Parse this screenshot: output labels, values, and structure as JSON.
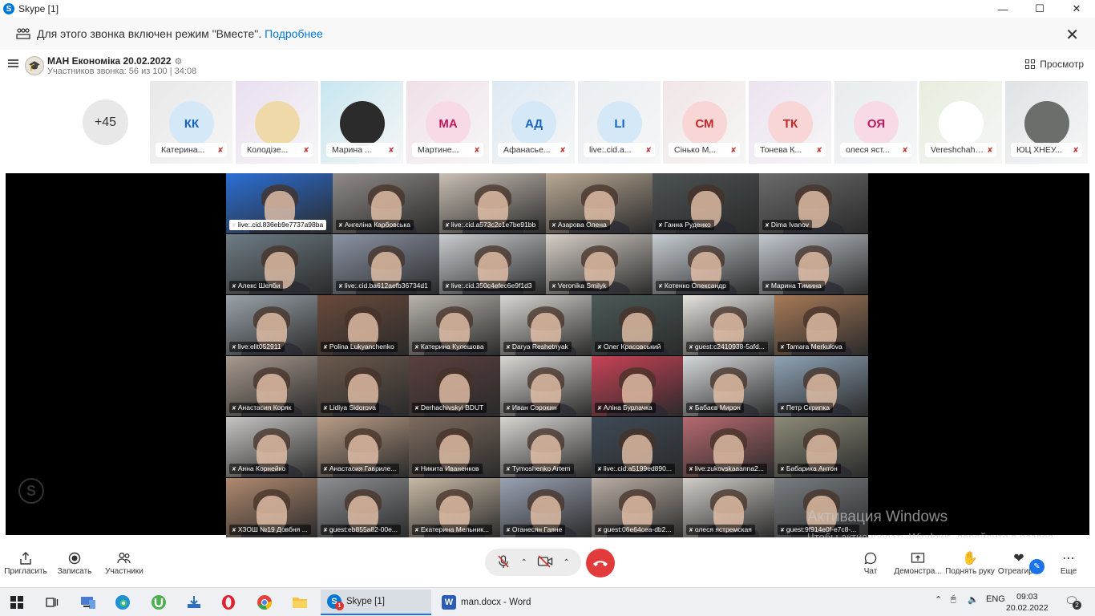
{
  "window": {
    "title": "Skype [1]"
  },
  "banner": {
    "message": "Для этого звонка включен режим \"Вместе\".",
    "link": "Подробнее"
  },
  "header": {
    "title": "МАН Економіка 20.02.2022",
    "subtitle": "Участников звонка: 56 из 100 | 34:08",
    "view_label": "Просмотр"
  },
  "strip": {
    "more_count": "+45",
    "participants": [
      {
        "initials": "КК",
        "name": "Катерина...",
        "bg": "#e8e8e8",
        "fg": "#1565c0",
        "circle": "#d5e8f7"
      },
      {
        "initials": "",
        "name": "Колодізе...",
        "bg": "#e9dff0",
        "fg": "#333",
        "circle": "#f0d9a8"
      },
      {
        "initials": "",
        "name": "Марина ...",
        "bg": "#c7e6ef",
        "fg": "#333",
        "circle": "#2b2b2b"
      },
      {
        "initials": "МА",
        "name": "Мартине...",
        "bg": "#efe0e8",
        "fg": "#c2185b",
        "circle": "#f8d9e6"
      },
      {
        "initials": "АД",
        "name": "Афанасье...",
        "bg": "#dde9f3",
        "fg": "#1565c0",
        "circle": "#d5e8f7"
      },
      {
        "initials": "LI",
        "name": "live:.cid.a...",
        "bg": "#e9eef2",
        "fg": "#1565c0",
        "circle": "#d5e8f7"
      },
      {
        "initials": "СМ",
        "name": "Сінько М...",
        "bg": "#f1e6e6",
        "fg": "#c62828",
        "circle": "#f9d6d6"
      },
      {
        "initials": "ТК",
        "name": "Тонева К...",
        "bg": "#ece3f0",
        "fg": "#c62828",
        "circle": "#f9d6d6"
      },
      {
        "initials": "ОЯ",
        "name": "олеся яст...",
        "bg": "#e7ecef",
        "fg": "#c2185b",
        "circle": "#f8d9e6"
      },
      {
        "initials": "",
        "name": "Vereshchahin...",
        "bg": "#e6eedd",
        "fg": "#333",
        "circle": "#ffffff"
      },
      {
        "initials": "",
        "name": "ЮЦ ХНЕУ...",
        "bg": "#dfe3e6",
        "fg": "#333",
        "circle": "#6a6f6c"
      }
    ]
  },
  "grid": {
    "rows": [
      [
        {
          "name": "live:.cid.836eb9e7737a98ba",
          "bg": "#2b6fd6"
        },
        {
          "name": "Ангеліна Карбовська",
          "bg": "#8f8a86"
        },
        {
          "name": "live:.cid.a573c2c1e7be91bb",
          "bg": "#c9bfb4"
        },
        {
          "name": "Азарова Олена",
          "bg": "#b9a995"
        },
        {
          "name": "Ганна Руденко",
          "bg": "#4c5253"
        },
        {
          "name": "Dima Ivanov",
          "bg": "#6b6b6b"
        }
      ],
      [
        {
          "name": "Алекс Шелби",
          "bg": "#6d7c84"
        },
        {
          "name": "live:.cid.ba612aefb36734d1",
          "bg": "#8b93a4"
        },
        {
          "name": "live:.cid.350c4efec6e9f1d3",
          "bg": "#c9ccd0"
        },
        {
          "name": "Veronika Smilyk",
          "bg": "#d6cfc7"
        },
        {
          "name": "Котенко Олександр",
          "bg": "#c7cdd2"
        },
        {
          "name": "Марина Тимина",
          "bg": "#c2c8cf"
        }
      ],
      [
        {
          "name": "live:elit052911",
          "bg": "#9aa3aa"
        },
        {
          "name": "Polina Lukyanchenko",
          "bg": "#6a4a3b"
        },
        {
          "name": "Катерина Кулешова",
          "bg": "#b9b4ad"
        },
        {
          "name": "Darya Reshetnyak",
          "bg": "#d8d6d2"
        },
        {
          "name": "Олег Красовський",
          "bg": "#4b5a57"
        },
        {
          "name": "guest:c2410938-5afd...",
          "bg": "#e7e4df"
        },
        {
          "name": "Tamara Merkulova",
          "bg": "#a77a57"
        }
      ],
      [
        {
          "name": "Анастасия Коряк",
          "bg": "#a89a8e"
        },
        {
          "name": "Lidiya Sidorova",
          "bg": "#6c5a4d"
        },
        {
          "name": "Derhachivskyi BDUT",
          "bg": "#5b3f3f"
        },
        {
          "name": "Иван Сорокин",
          "bg": "#d9d7d4"
        },
        {
          "name": "Аліна Бурлачка",
          "bg": "#c74256"
        },
        {
          "name": "Бабаєв Мирон",
          "bg": "#d5d8db"
        },
        {
          "name": "Петр Скрипка",
          "bg": "#8fa3b6"
        }
      ],
      [
        {
          "name": "Анна Корнейко",
          "bg": "#c6c5c3"
        },
        {
          "name": "Анастасия Гавриле...",
          "bg": "#b99d87"
        },
        {
          "name": "Никита Иваненков",
          "bg": "#7d6b5e"
        },
        {
          "name": "Tymoshenko Artem",
          "bg": "#d7d5d2"
        },
        {
          "name": "live:.cid.a5199ed890...",
          "bg": "#3f4a56"
        },
        {
          "name": "live:zukovskaaanna2...",
          "bg": "#b66a6f"
        },
        {
          "name": "Бабарика Антон",
          "bg": "#8c8b78"
        }
      ],
      [
        {
          "name": "ХЗОШ №19 Довбня ...",
          "bg": "#b08a6f"
        },
        {
          "name": "guest:eb855a82-00e...",
          "bg": "#8d8f92"
        },
        {
          "name": "Екатерина Мельник...",
          "bg": "#c8b9a5"
        },
        {
          "name": "Оганесян Гаяне",
          "bg": "#9aa2b3"
        },
        {
          "name": "guest:06e64cea-db2...",
          "bg": "#b9aea4"
        },
        {
          "name": "олеся ястремская",
          "bg": "#d0cdc8"
        },
        {
          "name": "guest:9f914e0f-e7c8-...",
          "bg": "#7a7e82"
        }
      ]
    ]
  },
  "watermark": {
    "line1": "Активация Windows",
    "line2": "Чтобы активировать Windows, перейдите в раздел \"Параметры\"."
  },
  "controls": {
    "invite": "Пригласить",
    "record": "Записать",
    "participants": "Участники",
    "chat": "Чат",
    "share": "Демонстра...",
    "raise_hand": "Поднять руку",
    "react": "Отреагир...",
    "more": "Еще"
  },
  "taskbar": {
    "skype_label": "Skype [1]",
    "skype_badge": "1",
    "word_label": "man.docx - Word",
    "lang": "ENG",
    "time": "09:03",
    "date": "20.02.2022",
    "notif_count": "2"
  }
}
